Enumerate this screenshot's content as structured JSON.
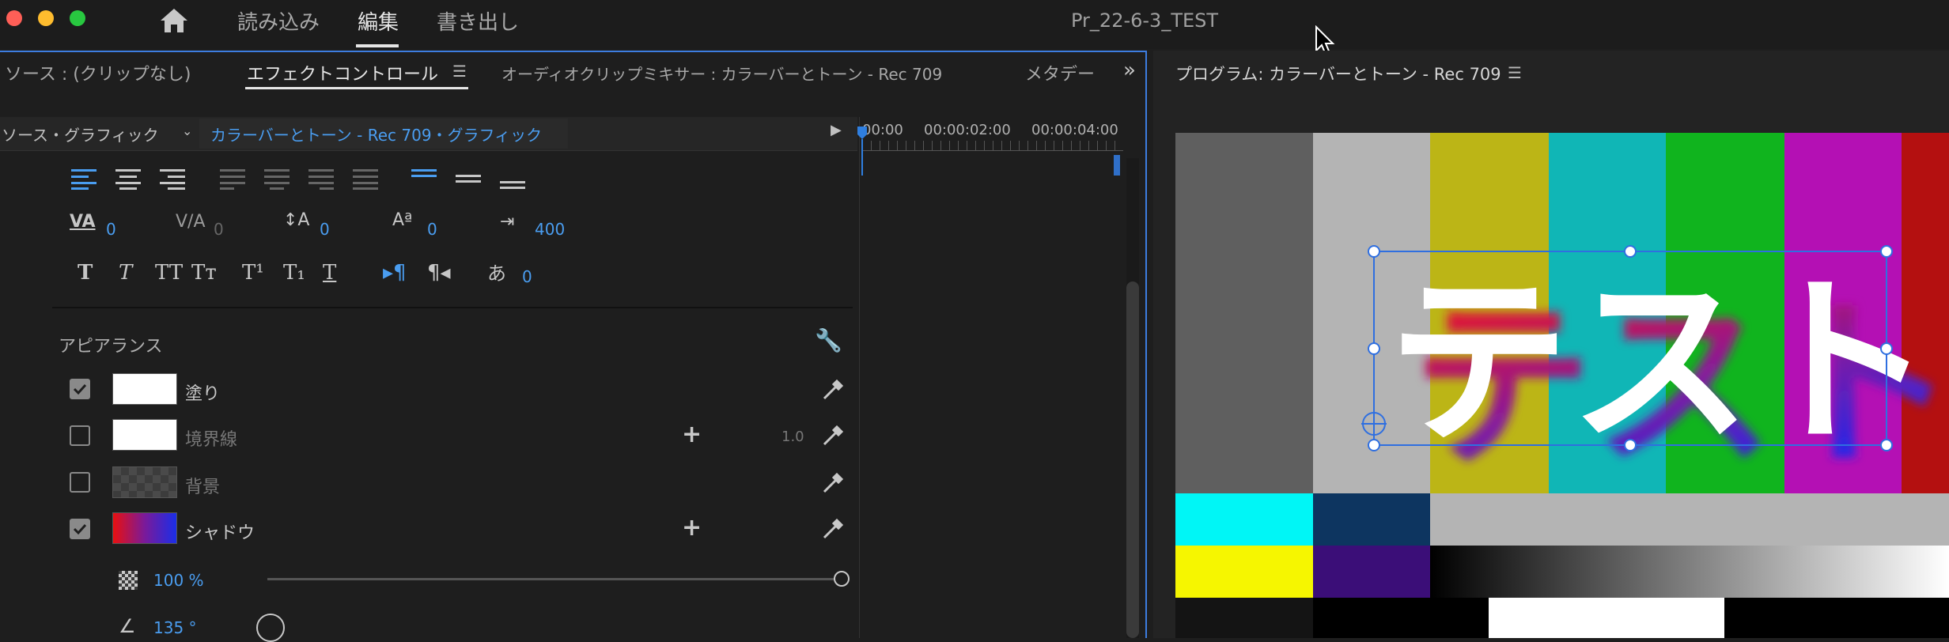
{
  "header": {
    "nav": [
      "読み込み",
      "編集",
      "書き出し"
    ],
    "project_title": "Pr_22-6-3_TEST"
  },
  "left_tabs": {
    "source": "ソース : (クリップなし)",
    "effect_controls": "エフェクトコントロール",
    "audio_mixer": "オーディオクリップミキサー : カラーバーとトーン - Rec 709",
    "metadata": "メタデー"
  },
  "source_bar": {
    "label": "ソース・グラフィック",
    "clip": "カラーバーとトーン - Rec 709・グラフィック"
  },
  "timeline": {
    "ticks": [
      "00:00",
      "00:00:02:00",
      "00:00:04:00"
    ]
  },
  "text_props": {
    "tracking": "0",
    "kerning": "0",
    "leading": "0",
    "baseline": "0",
    "tab_width": "400",
    "tsume": "0"
  },
  "appearance": {
    "title": "アピアランス",
    "fill": {
      "label": "塗り",
      "checked": true,
      "color": "#ffffff"
    },
    "stroke": {
      "label": "境界線",
      "checked": false,
      "color": "#ffffff",
      "width": "1.0"
    },
    "background": {
      "label": "背景",
      "checked": false
    },
    "shadow": {
      "label": "シャドウ",
      "checked": true,
      "gradient": [
        "#e81010",
        "#1a2ee8"
      ]
    },
    "opacity": "100 %",
    "angle": "135 °"
  },
  "program": {
    "title": "プログラム: カラーバーとトーン - Rec 709",
    "text": "テスト"
  },
  "colors": {
    "accent": "#4a9df0",
    "panel_border": "#3d7de0"
  }
}
